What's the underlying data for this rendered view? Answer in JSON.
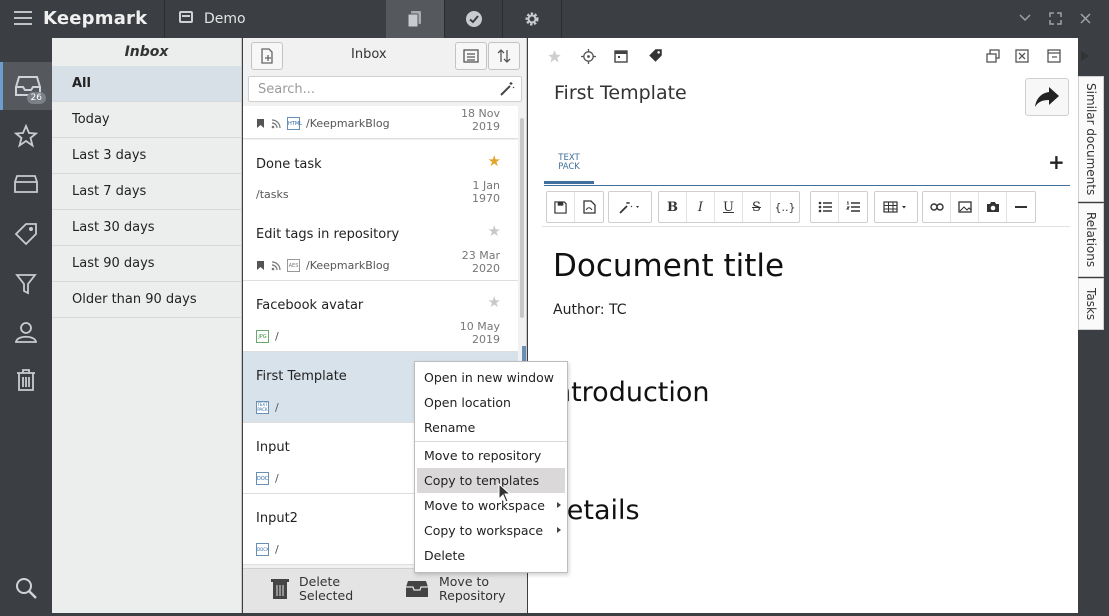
{
  "app": {
    "name": "Keepmark",
    "workspace": "Demo"
  },
  "nav": {
    "inbox_count": "26"
  },
  "filters": {
    "header": "Inbox",
    "items": [
      "All",
      "Today",
      "Last 3 days",
      "Last 7 days",
      "Last 30 days",
      "Last 90 days",
      "Older than 90 days"
    ],
    "active_index": 0
  },
  "doclist": {
    "title": "Inbox",
    "search_placeholder": "Search...",
    "items": [
      {
        "title": "",
        "path": "/KeepmarkBlog",
        "date_line1": "18 Nov",
        "date_line2": "2019",
        "type": "HTML",
        "starred": false
      },
      {
        "title": "Done task",
        "path": "/tasks",
        "date_line1": "1 Jan",
        "date_line2": "1970",
        "type": "",
        "starred": true
      },
      {
        "title": "Edit tags in repository",
        "path": "/KeepmarkBlog",
        "date_line1": "23 Mar",
        "date_line2": "2020",
        "type": "AES",
        "starred": false
      },
      {
        "title": "Facebook avatar",
        "path": "/",
        "date_line1": "10 May",
        "date_line2": "2019",
        "type": "JPG",
        "starred": false
      },
      {
        "title": "First Template",
        "path": "/",
        "date_line1": "",
        "date_line2": "",
        "type": "TEXT PACK",
        "starred": false
      },
      {
        "title": "Input",
        "path": "/",
        "date_line1": "",
        "date_line2": "",
        "type": "DOC",
        "starred": false
      },
      {
        "title": "Input2",
        "path": "/",
        "date_line1": "",
        "date_line2": "",
        "type": "DOCX",
        "starred": false
      }
    ],
    "footer": {
      "delete_line1": "Delete",
      "delete_line2": "Selected",
      "move_line1": "Move to",
      "move_line2": "Repository"
    }
  },
  "editor": {
    "doc_title": "First Template",
    "tab_icon_line1": "TEXT",
    "tab_icon_line2": "PACK",
    "format_buttons": [
      "B",
      "I",
      "U",
      "S",
      "{..}"
    ],
    "content": {
      "heading": "Document title",
      "author": "Author: TC",
      "section1": "Introduction",
      "section2": "Details"
    }
  },
  "side_tabs": [
    "Similar documents",
    "Relations",
    "Tasks"
  ],
  "context_menu": {
    "items": [
      {
        "label": "Open in new window",
        "submenu": false,
        "highlighted": false
      },
      {
        "label": "Open location",
        "submenu": false,
        "highlighted": false
      },
      {
        "label": "Rename",
        "submenu": false,
        "highlighted": false
      },
      {
        "label": "Move to repository",
        "submenu": false,
        "highlighted": false
      },
      {
        "label": "Copy to templates",
        "submenu": false,
        "highlighted": true
      },
      {
        "label": "Move to workspace",
        "submenu": true,
        "highlighted": false
      },
      {
        "label": "Copy to workspace",
        "submenu": true,
        "highlighted": false
      },
      {
        "label": "Delete",
        "submenu": false,
        "highlighted": false
      }
    ]
  },
  "colors": {
    "accent": "#3f6f9a",
    "star_on": "#e3a42b",
    "chrome": "#3b3e42",
    "selected_row": "#d8e2ea"
  }
}
